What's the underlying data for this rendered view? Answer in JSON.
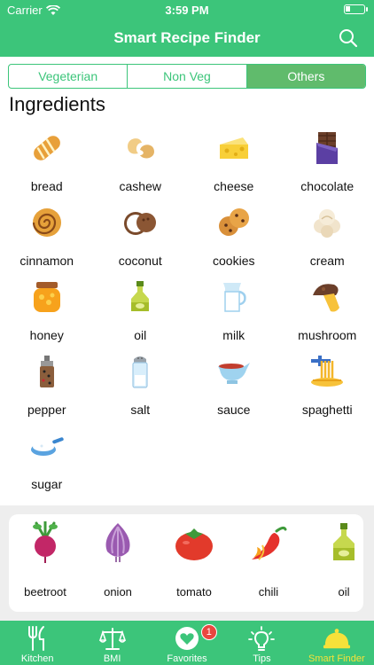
{
  "status_bar": {
    "carrier": "Carrier",
    "time": "3:59 PM"
  },
  "header": {
    "title": "Smart Recipe Finder",
    "search_icon": "search-icon"
  },
  "segments": [
    {
      "label": "Vegeterian",
      "active": false
    },
    {
      "label": "Non Veg",
      "active": false
    },
    {
      "label": "Others",
      "active": true
    }
  ],
  "ingredients_title": "Ingredients",
  "ingredients": [
    {
      "label": "bread",
      "icon": "bread-icon"
    },
    {
      "label": "cashew",
      "icon": "cashew-icon"
    },
    {
      "label": "cheese",
      "icon": "cheese-icon"
    },
    {
      "label": "chocolate",
      "icon": "chocolate-icon"
    },
    {
      "label": "cinnamon",
      "icon": "cinnamon-icon"
    },
    {
      "label": "coconut",
      "icon": "coconut-icon"
    },
    {
      "label": "cookies",
      "icon": "cookies-icon"
    },
    {
      "label": "cream",
      "icon": "cream-icon"
    },
    {
      "label": "honey",
      "icon": "honey-icon"
    },
    {
      "label": "oil",
      "icon": "oil-icon"
    },
    {
      "label": "milk",
      "icon": "milk-icon"
    },
    {
      "label": "mushroom",
      "icon": "mushroom-icon"
    },
    {
      "label": "pepper",
      "icon": "pepper-icon"
    },
    {
      "label": "salt",
      "icon": "salt-icon"
    },
    {
      "label": "sauce",
      "icon": "sauce-icon"
    },
    {
      "label": "spaghetti",
      "icon": "spaghetti-icon"
    },
    {
      "label": "sugar",
      "icon": "sugar-icon"
    }
  ],
  "selected": [
    {
      "label": "beetroot",
      "icon": "beetroot-icon"
    },
    {
      "label": "onion",
      "icon": "onion-icon"
    },
    {
      "label": "tomato",
      "icon": "tomato-icon"
    },
    {
      "label": "chili",
      "icon": "chili-icon"
    },
    {
      "label": "oil",
      "icon": "oil-icon"
    }
  ],
  "tabs": [
    {
      "label": "Kitchen",
      "icon": "fork-knife-icon",
      "active": false
    },
    {
      "label": "BMI",
      "icon": "scale-icon",
      "active": false
    },
    {
      "label": "Favorites",
      "icon": "heart-icon",
      "active": false,
      "badge": "1"
    },
    {
      "label": "Tips",
      "icon": "lightbulb-icon",
      "active": false
    },
    {
      "label": "Smart Finder",
      "icon": "cloche-icon",
      "active": true
    }
  ],
  "colors": {
    "brand": "#3cc57a",
    "segment_active": "#60bb6c",
    "active_tab": "#f6e13a",
    "badge": "#e9463f"
  }
}
